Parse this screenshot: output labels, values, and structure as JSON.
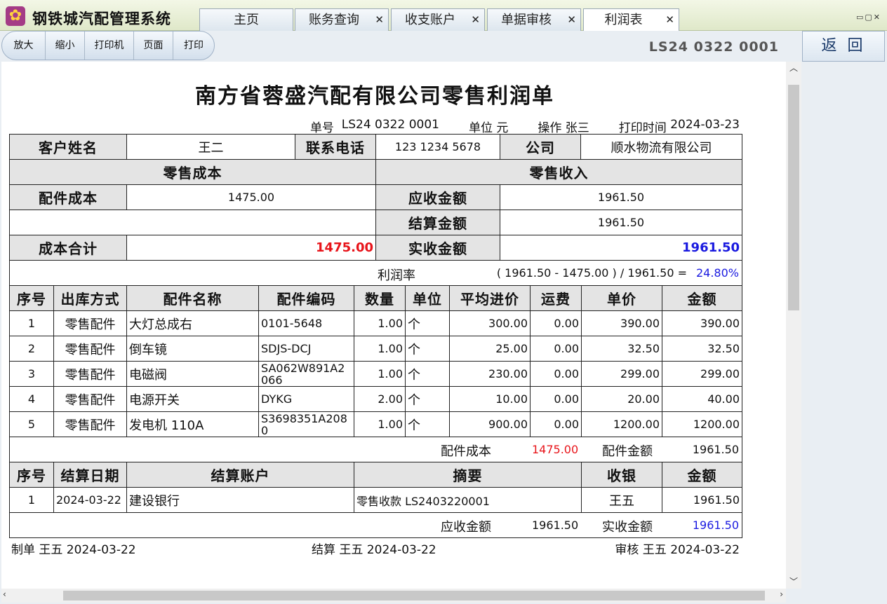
{
  "app": {
    "title": "钢铁城汽配管理系统",
    "icon": "gear-flower-icon"
  },
  "tabs": [
    {
      "label": "主页",
      "closable": false
    },
    {
      "label": "账务查询",
      "closable": true
    },
    {
      "label": "收支账户",
      "closable": true
    },
    {
      "label": "单据审核",
      "closable": true
    },
    {
      "label": "利润表",
      "closable": true,
      "active": true
    }
  ],
  "window_controls": "▭▢✕",
  "toolbar": {
    "buttons": [
      "放大",
      "缩小",
      "打印机",
      "页面",
      "打印"
    ],
    "doc_number": "LS24 0322 0001",
    "back_label": "返 回"
  },
  "doc": {
    "title": "南方省蓉盛汽配有限公司零售利润单",
    "meta": {
      "no_label": "单号",
      "no_value": "LS24 0322 0001",
      "unit_label": "单位",
      "unit_value": "元",
      "operator_label": "操作",
      "operator_value": "张三",
      "print_label": "打印时间",
      "print_value": "2024-03-23"
    },
    "customer": {
      "name_label": "客户姓名",
      "name_value": "王二",
      "phone_label": "联系电话",
      "phone_value": "123 1234 5678",
      "company_label": "公司",
      "company_value": "顺水物流有限公司"
    },
    "summary": {
      "cost_header": "零售成本",
      "income_header": "零售收入",
      "part_cost_label": "配件成本",
      "part_cost_value": "1475.00",
      "receivable_label": "应收金额",
      "receivable_value": "1961.50",
      "settled_label": "结算金额",
      "settled_value": "1961.50",
      "cost_total_label": "成本合计",
      "cost_total_value": "1475.00",
      "received_label": "实收金额",
      "received_value": "1961.50",
      "margin_label": "利润率",
      "margin_formula": "( 1961.50 - 1475.00 ) / 1961.50 =",
      "margin_value": "24.80%"
    },
    "items_header": [
      "序号",
      "出库方式",
      "配件名称",
      "配件编码",
      "数量",
      "单位",
      "平均进价",
      "运费",
      "单价",
      "金额"
    ],
    "items": [
      {
        "no": "1",
        "method": "零售配件",
        "name": "大灯总成右",
        "code": "0101-5648",
        "qty": "1.00",
        "unit": "个",
        "avg_price": "300.00",
        "freight": "0.00",
        "price": "390.00",
        "amount": "390.00"
      },
      {
        "no": "2",
        "method": "零售配件",
        "name": "倒车镜",
        "code": "SDJS-DCJ",
        "qty": "1.00",
        "unit": "个",
        "avg_price": "25.00",
        "freight": "0.00",
        "price": "32.50",
        "amount": "32.50"
      },
      {
        "no": "3",
        "method": "零售配件",
        "name": "电磁阀",
        "code": "SA062W891A2066",
        "qty": "1.00",
        "unit": "个",
        "avg_price": "230.00",
        "freight": "0.00",
        "price": "299.00",
        "amount": "299.00"
      },
      {
        "no": "4",
        "method": "零售配件",
        "name": "电源开关",
        "code": "DYKG",
        "qty": "2.00",
        "unit": "个",
        "avg_price": "10.00",
        "freight": "0.00",
        "price": "20.00",
        "amount": "40.00"
      },
      {
        "no": "5",
        "method": "零售配件",
        "name": "发电机 110A",
        "code": "S3698351A2080",
        "qty": "1.00",
        "unit": "个",
        "avg_price": "900.00",
        "freight": "0.00",
        "price": "1200.00",
        "amount": "1200.00"
      }
    ],
    "items_footer": {
      "cost_label": "配件成本",
      "cost_value": "1475.00",
      "amount_label": "配件金额",
      "amount_value": "1961.50"
    },
    "settle_header": [
      "序号",
      "结算日期",
      "结算账户",
      "摘要",
      "收银",
      "金额"
    ],
    "settlements": [
      {
        "no": "1",
        "date": "2024-03-22",
        "account": "建设银行",
        "memo": "零售收款 LS2403220001",
        "cashier": "王五",
        "amount": "1961.50"
      }
    ],
    "settle_footer": {
      "receivable_label": "应收金额",
      "receivable_value": "1961.50",
      "received_label": "实收金额",
      "received_value": "1961.50"
    },
    "signatures": {
      "maker": "制单 王五 2024-03-22",
      "settler": "结算 王五 2024-03-22",
      "auditor": "审核 王五 2024-03-22"
    }
  },
  "colors": {
    "red": "#e8141a",
    "blue": "#1a1ae0",
    "header_gray": "#e4e4e4"
  }
}
